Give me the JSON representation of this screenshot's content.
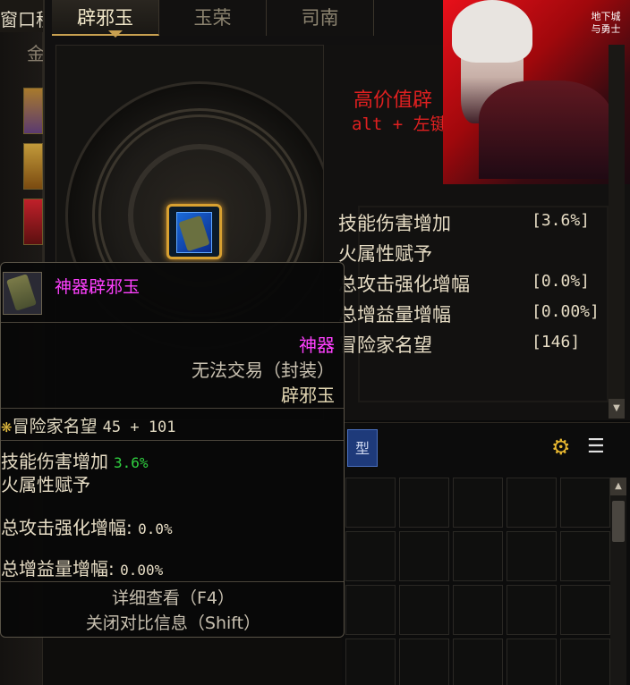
{
  "left": {
    "title": "窗口移",
    "subtitle": "金"
  },
  "tabs": [
    {
      "label": "辟邪玉"
    },
    {
      "label": "玉荣"
    },
    {
      "label": "司南"
    }
  ],
  "hint": {
    "line1": "高价值辟",
    "line2": "alt + 左键"
  },
  "banner": {
    "logo_text": "地下城与勇士"
  },
  "stats": [
    {
      "label": "技能伤害增加",
      "value": "[3.6%]"
    },
    {
      "label": "火属性赋予",
      "value": ""
    },
    {
      "label": "总攻击强化增幅",
      "value": "[0.0%]"
    },
    {
      "label": "总增益量增幅",
      "value": "[0.00%]"
    },
    {
      "label": "冒险家名望",
      "value": "[146]"
    }
  ],
  "inventory": {
    "button_label": "型"
  },
  "tooltip": {
    "item_name": "神器辟邪玉",
    "grade": "神器",
    "trade": "无法交易（封装）",
    "type": "辟邪玉",
    "fame_label": "冒险家名望",
    "fame_value": "45 + 101",
    "stats": [
      {
        "label": "技能伤害增加",
        "value": "3.6%"
      },
      {
        "label": "火属性赋予",
        "value": ""
      },
      {
        "label": "总攻击强化增幅:",
        "value": "0.0%"
      },
      {
        "label": "总增益量增幅:",
        "value": "0.00%"
      }
    ],
    "detail": "详细查看（F4）",
    "close_compare": "关闭对比信息（Shift）"
  },
  "colors": {
    "epic_pink": "#ff40ff",
    "hint_red": "#e02020",
    "stat_green": "#30d040",
    "gold_border": "#d8a030"
  }
}
